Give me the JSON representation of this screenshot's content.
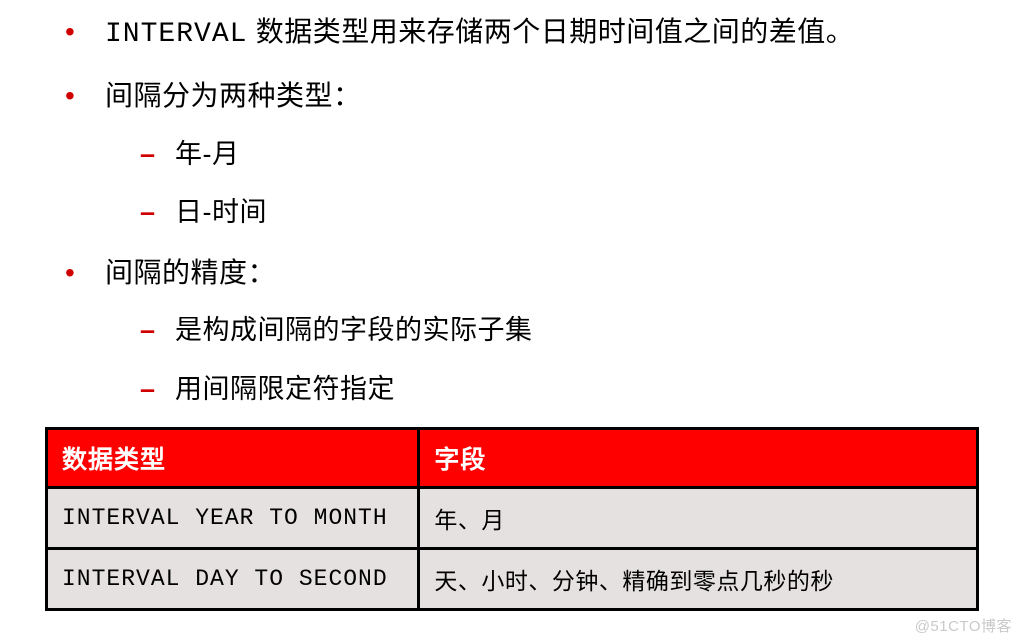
{
  "bullets": {
    "b1_code": "INTERVAL",
    "b1_text": " 数据类型用来存储两个日期时间值之间的差值。",
    "b2": "间隔分为两种类型：",
    "b2_sub1": "年-月",
    "b2_sub2": "日-时间",
    "b3": "间隔的精度：",
    "b3_sub1": "是构成间隔的字段的实际子集",
    "b3_sub2": "用间隔限定符指定"
  },
  "table": {
    "headers": {
      "type": "数据类型",
      "field": "字段"
    },
    "rows": [
      {
        "type": "INTERVAL YEAR TO MONTH",
        "field": "年、月"
      },
      {
        "type": "INTERVAL DAY TO SECOND",
        "field": "天、小时、分钟、精确到零点几秒的秒"
      }
    ]
  },
  "watermark": "@51CTO博客"
}
